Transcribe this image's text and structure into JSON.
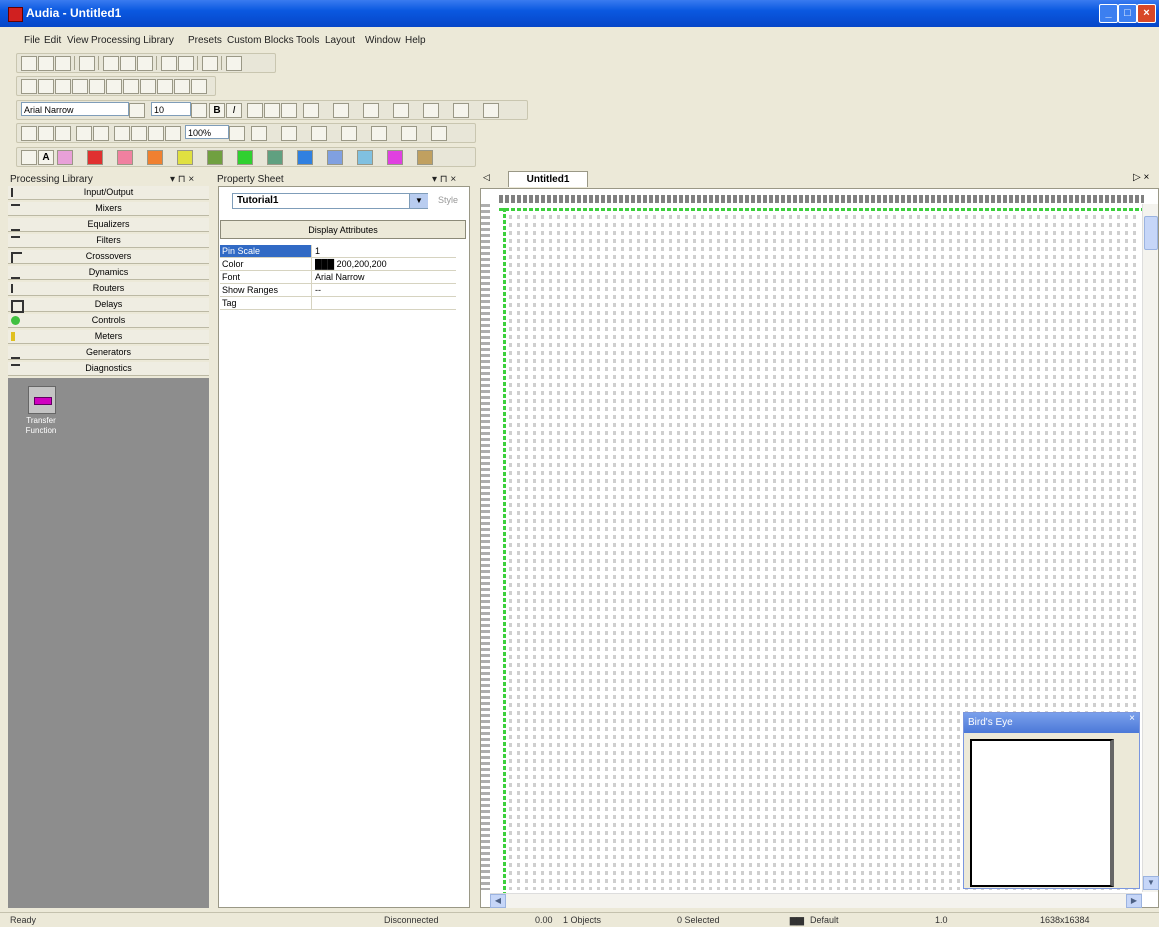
{
  "window": {
    "title": "Audia - Untitled1",
    "min_label": "_",
    "max_label": "□",
    "close_label": "×"
  },
  "menu": [
    "File",
    "Edit",
    "View",
    "Processing Library",
    "Presets",
    "Custom Blocks",
    "Tools",
    "Layout",
    "Window",
    "Help"
  ],
  "formatting": {
    "font_name": "Arial Narrow",
    "font_size": "10",
    "bold_label": "B",
    "italic_label": "I"
  },
  "zoom": {
    "value": "100%"
  },
  "library": {
    "header": "Processing Library",
    "controls": "▾ ⊓ ×",
    "categories": [
      {
        "label": "Input/Output",
        "icon": "input-output-icon"
      },
      {
        "label": "Mixers",
        "icon": "mixers-icon"
      },
      {
        "label": "Equalizers",
        "icon": "equalizers-icon"
      },
      {
        "label": "Filters",
        "icon": "filters-icon"
      },
      {
        "label": "Crossovers",
        "icon": "crossovers-icon"
      },
      {
        "label": "Dynamics",
        "icon": "dynamics-icon"
      },
      {
        "label": "Routers",
        "icon": "routers-icon"
      },
      {
        "label": "Delays",
        "icon": "delays-icon"
      },
      {
        "label": "Controls",
        "icon": "controls-icon"
      },
      {
        "label": "Meters",
        "icon": "meters-icon"
      },
      {
        "label": "Generators",
        "icon": "generators-icon"
      },
      {
        "label": "Diagnostics",
        "icon": "diagnostics-icon"
      }
    ],
    "selected_block": {
      "label": "Transfer Function",
      "icon": "transfer-function-icon"
    }
  },
  "property_sheet": {
    "header": "Property Sheet",
    "controls": "▾ ⊓ ×",
    "object_select": "Tutorial1",
    "style_label": "Style",
    "display_attributes_label": "Display Attributes",
    "rows": [
      {
        "name": "Pin Scale",
        "value": "1"
      },
      {
        "name": "Color",
        "value": "███ 200,200,200"
      },
      {
        "name": "Font",
        "value": "Arial Narrow"
      },
      {
        "name": "Show Ranges",
        "value": "--"
      },
      {
        "name": "Tag",
        "value": ""
      }
    ]
  },
  "canvas": {
    "tab_label": "Untitled1",
    "nav_label": "▷ ×",
    "tab_scroll": "◁"
  },
  "birds_eye": {
    "title": "Bird's Eye",
    "close_label": "×"
  },
  "status": {
    "ready": "Ready",
    "connection": "Disconnected",
    "value": "0.00",
    "objects": "1 Objects",
    "selected": "0 Selected",
    "layout": "Default",
    "zoom_factor": "1.0",
    "canvas_size": "1638x16384"
  }
}
